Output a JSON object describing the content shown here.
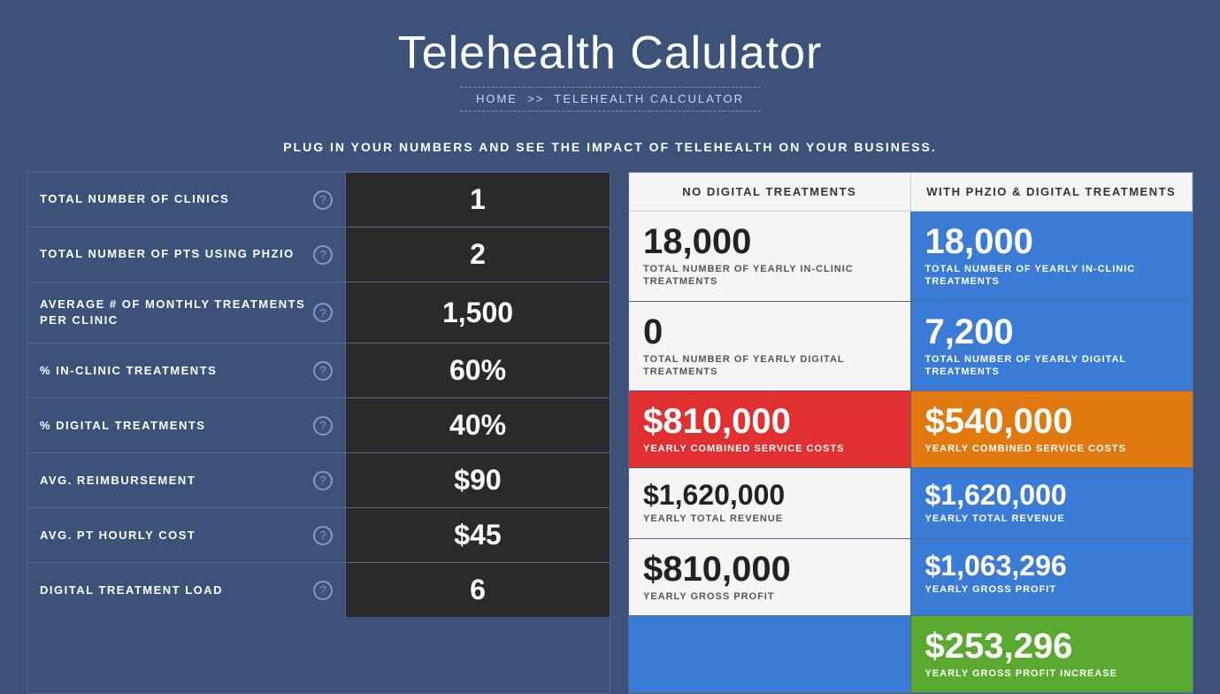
{
  "header": {
    "title": "Telehealth Calulator",
    "breadcrumb": {
      "home": "HOME",
      "separator": ">>",
      "current": "TELEHEALTH CALCULATOR"
    },
    "subtitle": "PLUG IN YOUR NUMBERS AND SEE THE IMPACT OF TELEHEALTH ON YOUR BUSINESS."
  },
  "left_panel": {
    "rows": [
      {
        "label": "TOTAL NUMBER OF CLINICS",
        "value": "1",
        "id": "clinics"
      },
      {
        "label": "TOTAL NUMBER OF PTS USING PHZIO",
        "value": "2",
        "id": "pts"
      },
      {
        "label": "AVERAGE # OF MONTHLY TREATMENTS PER CLINIC",
        "value": "1,500",
        "id": "avg-monthly"
      },
      {
        "label": "% IN-CLINIC TREATMENTS",
        "value": "60%",
        "id": "in-clinic-pct"
      },
      {
        "label": "% DIGITAL TREATMENTS",
        "value": "40%",
        "id": "digital-pct"
      },
      {
        "label": "AVG. REIMBURSEMENT",
        "value": "$90",
        "id": "avg-reimburse"
      },
      {
        "label": "AVG. PT HOURLY COST",
        "value": "$45",
        "id": "avg-hourly"
      },
      {
        "label": "DIGITAL TREATMENT LOAD",
        "value": "6",
        "id": "digital-load"
      }
    ]
  },
  "right_panel": {
    "col_headers": [
      "NO DIGITAL TREATMENTS",
      "WITH PHZIO & DIGITAL TREATMENTS"
    ],
    "rows": [
      {
        "no_digital": {
          "value": "18,000",
          "label": "TOTAL NUMBER OF YEARLY IN-CLINIC TREATMENTS",
          "style": "white"
        },
        "with_phzio": {
          "value": "18,000",
          "label": "TOTAL NUMBER OF YEARLY IN-CLINIC TREATMENTS",
          "style": "blue"
        }
      },
      {
        "no_digital": {
          "value": "0",
          "label": "TOTAL NUMBER OF YEARLY DIGITAL TREATMENTS",
          "style": "white"
        },
        "with_phzio": {
          "value": "7,200",
          "label": "TOTAL NUMBER OF YEARLY DIGITAL TREATMENTS",
          "style": "blue"
        }
      },
      {
        "no_digital": {
          "value": "$810,000",
          "label": "YEARLY COMBINED SERVICE COSTS",
          "style": "red"
        },
        "with_phzio": {
          "value": "$540,000",
          "label": "YEARLY COMBINED SERVICE COSTS",
          "style": "orange"
        }
      },
      {
        "no_digital": {
          "value": "$1,620,000",
          "label": "YEARLY TOTAL REVENUE",
          "style": "white"
        },
        "with_phzio": {
          "value": "$1,620,000",
          "label": "YEARLY TOTAL REVENUE",
          "style": "blue"
        }
      },
      {
        "no_digital": {
          "value": "$810,000",
          "label": "YEARLY GROSS PROFIT",
          "style": "white"
        },
        "with_phzio": {
          "value": "$1,063,296",
          "label": "YEARLY GROSS PROFIT",
          "style": "blue"
        }
      },
      {
        "no_digital": {
          "value": "",
          "label": "",
          "style": "blue-empty"
        },
        "with_phzio": {
          "value": "$253,296",
          "label": "YEARLY GROSS PROFIT INCREASE",
          "style": "green"
        }
      }
    ]
  }
}
